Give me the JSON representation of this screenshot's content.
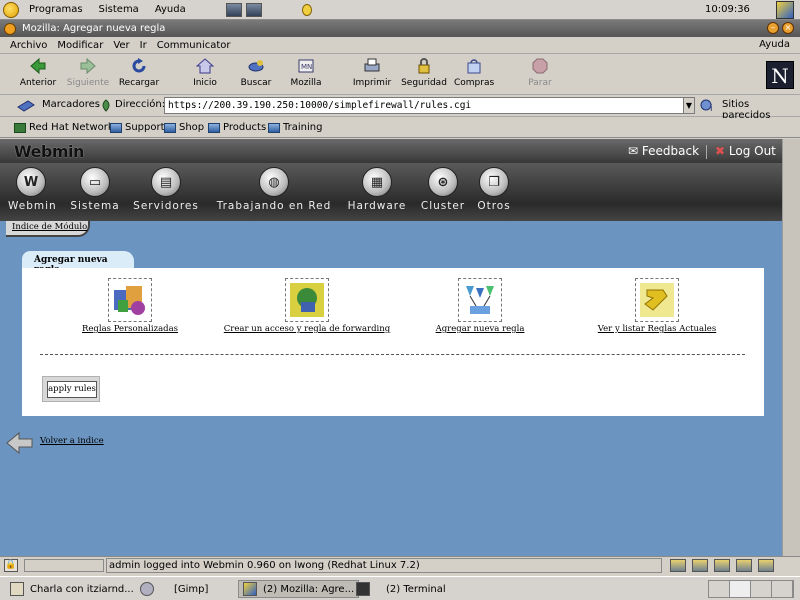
{
  "top_panel": {
    "menus": [
      "Programas",
      "Sistema",
      "Ayuda"
    ],
    "clock": "10:09:36"
  },
  "window": {
    "title": "Mozilla: Agregar nueva regla"
  },
  "menubar": {
    "items": [
      "Archivo",
      "Modificar",
      "Ver",
      "Ir",
      "Communicator"
    ],
    "help": "Ayuda"
  },
  "nav_toolbar": {
    "back": "Anterior",
    "forward": "Siguiente",
    "reload": "Recargar",
    "home": "Inicio",
    "search": "Buscar",
    "mozilla": "Mozilla",
    "print": "Imprimir",
    "security": "Seguridad",
    "shop": "Compras",
    "stop": "Parar",
    "logo": "N"
  },
  "location_bar": {
    "bookmarks_label": "Marcadores",
    "address_label": "Dirección:",
    "url": "https://200.39.190.250:10000/simplefirewall/rules.cgi",
    "related_label": "Sitios parecidos"
  },
  "personal_bar": {
    "items": [
      "Red Hat Network",
      "Support",
      "Shop",
      "Products",
      "Training"
    ]
  },
  "webmin": {
    "logo": "Webmin",
    "feedback": "Feedback",
    "logout": "Log Out",
    "categories": [
      "Webmin",
      "Sistema",
      "Servidores",
      "Trabajando en Red",
      "Hardware",
      "Cluster",
      "Otros"
    ],
    "module_index": "Indice de Módulo",
    "page_title": "Agregar nueva regla",
    "modules": [
      {
        "label": "Reglas Personalizadas",
        "icon": "custom-rules-icon"
      },
      {
        "label": "Crear un acceso y regla de forwarding",
        "icon": "forwarding-icon"
      },
      {
        "label": "Agregar nueva regla",
        "icon": "add-rule-icon"
      },
      {
        "label": "Ver y listar Reglas Actuales",
        "icon": "list-rules-icon"
      }
    ],
    "apply_button": "apply rules",
    "return_link": "Volver a indice"
  },
  "status_bar": {
    "text": "admin logged into Webmin 0.960 on lwong (Redhat Linux 7.2)"
  },
  "taskbar": {
    "tasks": [
      "Charla con itziarnd...",
      "[Gimp]",
      "(2) Mozilla: Agre...",
      "(2) Terminal"
    ]
  },
  "colors": {
    "page_background": "#6b95c0",
    "panel_tab": "#d9ecf8",
    "webmin_bar": "#3a3a3a"
  }
}
